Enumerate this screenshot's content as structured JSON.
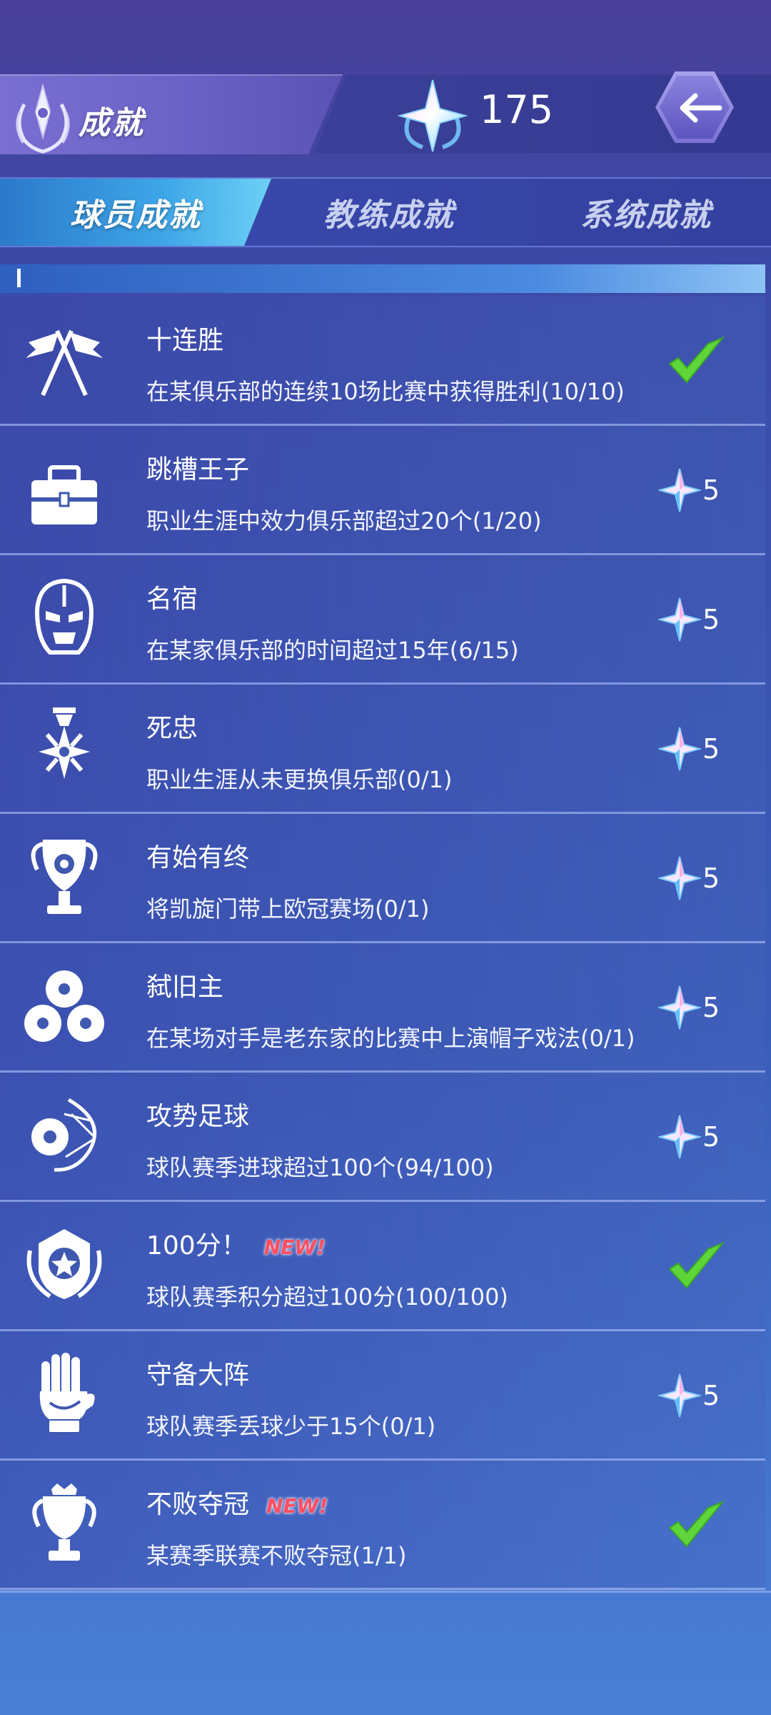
{
  "header": {
    "title": "成就",
    "points": "175",
    "back_button": "back-arrow-icon"
  },
  "tabs": [
    {
      "label": "球员成就",
      "active": true
    },
    {
      "label": "教练成就",
      "active": false
    },
    {
      "label": "系统成就",
      "active": false
    }
  ],
  "achievements": [
    {
      "icon": "crossed-flags-icon",
      "title": "十连胜",
      "desc": "在某俱乐部的连续10场比赛中获得胜利(10/10)",
      "status": "completed",
      "new": ""
    },
    {
      "icon": "toolbox-icon",
      "title": "跳槽王子",
      "desc": "职业生涯中效力俱乐部超过20个(1/20)",
      "reward": "5",
      "new": ""
    },
    {
      "icon": "helmet-icon",
      "title": "名宿",
      "desc": "在某家俱乐部的时间超过15年(6/15)",
      "reward": "5",
      "new": ""
    },
    {
      "icon": "medal-star-icon",
      "title": "死忠",
      "desc": "职业生涯从未更换俱乐部(0/1)",
      "reward": "5",
      "new": ""
    },
    {
      "icon": "trophy-ball-icon",
      "title": "有始有终",
      "desc": "将凯旋门带上欧冠赛场(0/1)",
      "reward": "5",
      "new": ""
    },
    {
      "icon": "three-balls-icon",
      "title": "弑旧主",
      "desc": "在某场对手是老东家的比赛中上演帽子戏法(0/1)",
      "reward": "5",
      "new": ""
    },
    {
      "icon": "ball-in-net-icon",
      "title": "攻势足球",
      "desc": "球队赛季进球超过100个(94/100)",
      "reward": "5",
      "new": ""
    },
    {
      "icon": "shield-star-icon",
      "title": "100分！",
      "desc": "球队赛季积分超过100分(100/100)",
      "status": "completed",
      "new": "NEW!"
    },
    {
      "icon": "goalkeeper-glove-icon",
      "title": "守备大阵",
      "desc": "球队赛季丢球少于15个(0/1)",
      "reward": "5",
      "new": ""
    },
    {
      "icon": "crown-trophy-icon",
      "title": "不败夺冠",
      "desc": "某赛季联赛不败夺冠(1/1)",
      "status": "completed",
      "new": "NEW!"
    }
  ]
}
